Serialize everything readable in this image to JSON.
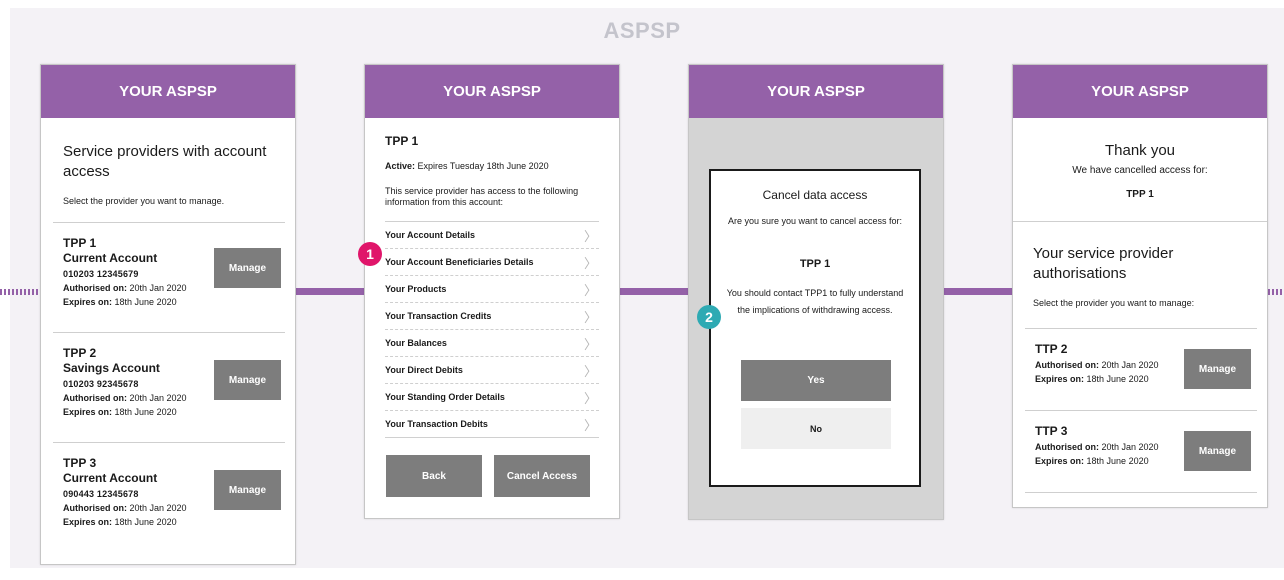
{
  "title": "ASPSP",
  "colors": {
    "accent": "#9461a8",
    "badge1": "#e0156a",
    "badge2": "#2eaab3",
    "button": "#7d7d7d"
  },
  "header": "YOUR ASPSP",
  "screen1": {
    "title": "Service providers with account access",
    "subtitle": "Select the provider you want to manage.",
    "items": [
      {
        "name": "TPP 1",
        "account": "Current Account",
        "number": "010203   12345679",
        "auth_label": "Authorised on:",
        "auth_value": "20th Jan 2020",
        "exp_label": "Expires on:",
        "exp_value": "18th June 2020",
        "button": "Manage"
      },
      {
        "name": "TPP 2",
        "account": "Savings Account",
        "number": "010203   92345678",
        "auth_label": "Authorised on:",
        "auth_value": "20th Jan 2020",
        "exp_label": "Expires on:",
        "exp_value": "18th June 2020",
        "button": "Manage"
      },
      {
        "name": "TPP 3",
        "account": "Current Account",
        "number": "090443   12345678",
        "auth_label": "Authorised on:",
        "auth_value": "20th Jan 2020",
        "exp_label": "Expires on:",
        "exp_value": "18th June 2020",
        "button": "Manage"
      }
    ]
  },
  "screen2": {
    "tpp": "TPP 1",
    "active_label": "Active:",
    "active_value": "Expires Tuesday 18th June 2020",
    "description": "This service provider has access to the following information from this account:",
    "rows": [
      "Your Account Details",
      "Your Account Beneficiaries Details",
      "Your Products",
      "Your Transaction Credits",
      "Your Balances",
      "Your Direct Debits",
      "Your Standing Order Details",
      "Your Transaction Debits"
    ],
    "back": "Back",
    "cancel": "Cancel Access"
  },
  "screen3": {
    "modal_title": "Cancel data access",
    "question": "Are you sure you want to cancel access for:",
    "tpp": "TPP 1",
    "note": "You should contact TPP1 to fully understand the implications of withdrawing access.",
    "yes": "Yes",
    "no": "No"
  },
  "screen4": {
    "thanks": "Thank you",
    "sub": "We have cancelled access for:",
    "tpp": "TPP 1",
    "title": "Your service provider authorisations",
    "select": "Select the provider you want to manage:",
    "items": [
      {
        "name": "TTP 2",
        "auth_label": "Authorised on:",
        "auth_value": "20th Jan 2020",
        "exp_label": "Expires on:",
        "exp_value": "18th June 2020",
        "button": "Manage"
      },
      {
        "name": "TTP 3",
        "auth_label": "Authorised on:",
        "auth_value": "20th Jan 2020",
        "exp_label": "Expires on:",
        "exp_value": "18th June 2020",
        "button": "Manage"
      }
    ]
  },
  "badges": [
    "1",
    "2"
  ]
}
